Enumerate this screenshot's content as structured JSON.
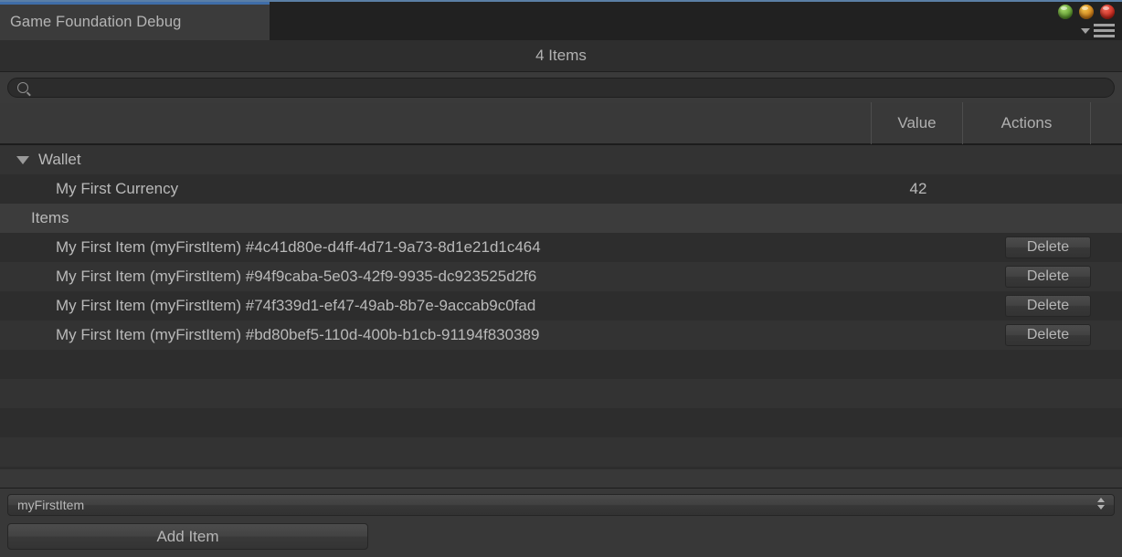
{
  "window": {
    "tab_label": "Game Foundation Debug",
    "title": "4 Items",
    "accent_color": "#3f6da8",
    "background_color": "#383838",
    "controls": [
      {
        "name": "minimize-orb",
        "color": "#5f9e2f"
      },
      {
        "name": "maximize-orb",
        "color": "#d98218"
      },
      {
        "name": "close-orb",
        "color": "#d2281c"
      }
    ],
    "menu_icons": [
      "filter-icon",
      "hamburger-menu-icon"
    ]
  },
  "search": {
    "value": "",
    "placeholder": "",
    "icon": "search-icon"
  },
  "columns": [
    {
      "label": "Value"
    },
    {
      "label": "Actions"
    }
  ],
  "tree": {
    "groups": [
      {
        "label": "Wallet",
        "expanded": true,
        "twisty": "chevron-down-icon",
        "children": [
          {
            "label": "My First Currency",
            "value": "42",
            "action": null
          }
        ]
      },
      {
        "label": "Items",
        "expanded": true,
        "twisty": null,
        "children": [
          {
            "label": "My First Item (myFirstItem) #4c41d80e-d4ff-4d71-9a73-8d1e21d1c464",
            "value": "",
            "action": "Delete"
          },
          {
            "label": "My First Item (myFirstItem) #94f9caba-5e03-42f9-9935-dc923525d2f6",
            "value": "",
            "action": "Delete"
          },
          {
            "label": "My First Item (myFirstItem) #74f339d1-ef47-49ab-8b7e-9accab9c0fad",
            "value": "",
            "action": "Delete"
          },
          {
            "label": "My First Item (myFirstItem) #bd80bef5-110d-400b-b1cb-91194f830389",
            "value": "",
            "action": "Delete"
          }
        ]
      }
    ]
  },
  "footer": {
    "dropdown_value": "myFirstItem",
    "add_button_label": "Add Item"
  }
}
